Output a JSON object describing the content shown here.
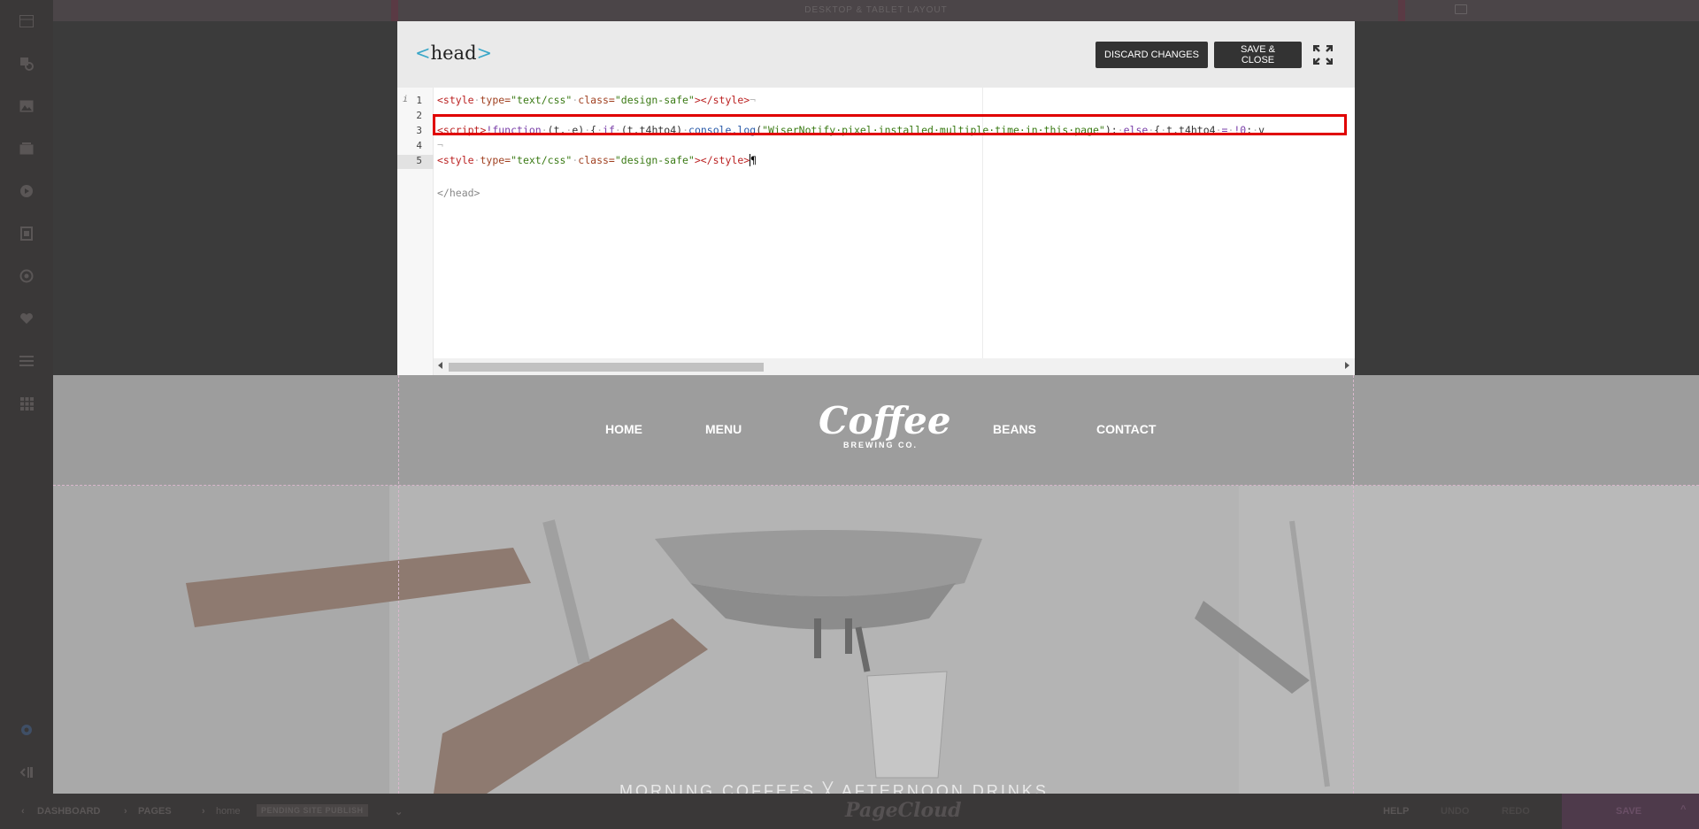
{
  "topbar": {
    "layout_label": "DESKTOP & TABLET LAYOUT"
  },
  "sidebar": {
    "items": [
      {
        "icon": "sections-icon"
      },
      {
        "icon": "shapes-icon"
      },
      {
        "icon": "image-icon"
      },
      {
        "icon": "gallery-icon"
      },
      {
        "icon": "video-icon"
      },
      {
        "icon": "pages-icon"
      },
      {
        "icon": "contact-icon"
      },
      {
        "icon": "favorites-icon"
      },
      {
        "icon": "menu-icon"
      },
      {
        "icon": "apps-icon"
      }
    ]
  },
  "modal": {
    "title_open": "<",
    "title_text": "head",
    "title_close": ">",
    "discard_label": "DISCARD CHANGES",
    "save_close_label": "SAVE & CLOSE"
  },
  "editor": {
    "line_numbers": [
      "1",
      "2",
      "3",
      "4",
      "5"
    ],
    "closing_tag": "</head>"
  },
  "site": {
    "nav": [
      "HOME",
      "MENU",
      "BEANS",
      "CONTACT"
    ],
    "logo_script": "Coffee",
    "logo_sub": "BREWING CO.",
    "hero_caption": "MORNING COFFEES  ╳  AFTERNOON DRINKS"
  },
  "bottombar": {
    "dashboard": "DASHBOARD",
    "pages": "PAGES",
    "page_name": "home",
    "pending": "PENDING SITE PUBLISH",
    "brand": "PageCloud",
    "help": "HELP",
    "undo": "UNDO",
    "redo": "REDO",
    "save": "SAVE"
  },
  "colors": {
    "accent_red": "#e00000",
    "button_dark": "#333333",
    "bracket_blue": "#3aa7c8"
  }
}
